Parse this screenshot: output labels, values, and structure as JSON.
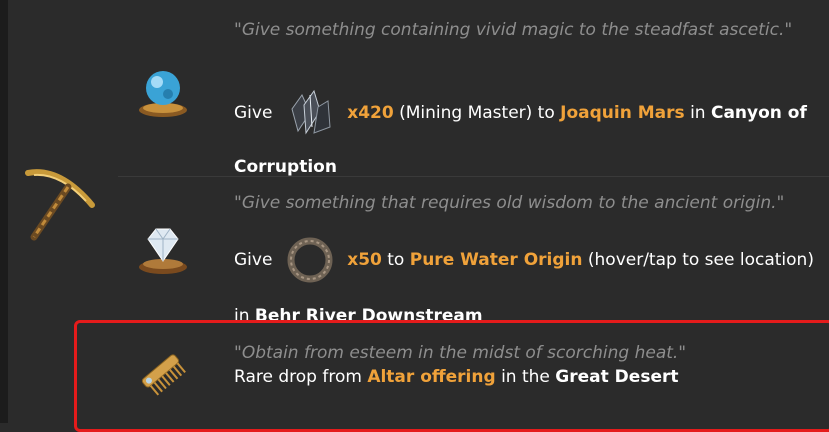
{
  "colors": {
    "background": "#2b2b2b",
    "quote": "#8e8e8e",
    "accent": "#f0a23a",
    "highlight": "#e51b1b"
  },
  "category_icon": "pickaxe-icon",
  "entries": [
    {
      "icon": "blue-orb-icon",
      "quote": "\"Give something containing vivid magic to the steadfast ascetic.\"",
      "give_label": "Give",
      "item_icon": "ore-crystal-icon",
      "quantity": "x420",
      "item_note": "(Mining Master) to",
      "npc": "Joaquin Mars",
      "in_label": "in",
      "location": "Canyon of Corruption"
    },
    {
      "icon": "diamond-pedestal-icon",
      "quote": "\"Give something that requires old wisdom to the ancient origin.\"",
      "give_label": "Give",
      "item_icon": "stone-ring-icon",
      "quantity": "x50",
      "to_label": "to",
      "npc": "Pure Water Origin",
      "note": "(hover/tap to see location) in",
      "location": "Behr River Downstream"
    },
    {
      "icon": "comb-icon",
      "quote": "\"Obtain from esteem in the midst of scorching heat.\"",
      "prefix": "Rare drop from",
      "source": "Altar offering",
      "in_the": "in the",
      "location": "Great Desert"
    }
  ]
}
